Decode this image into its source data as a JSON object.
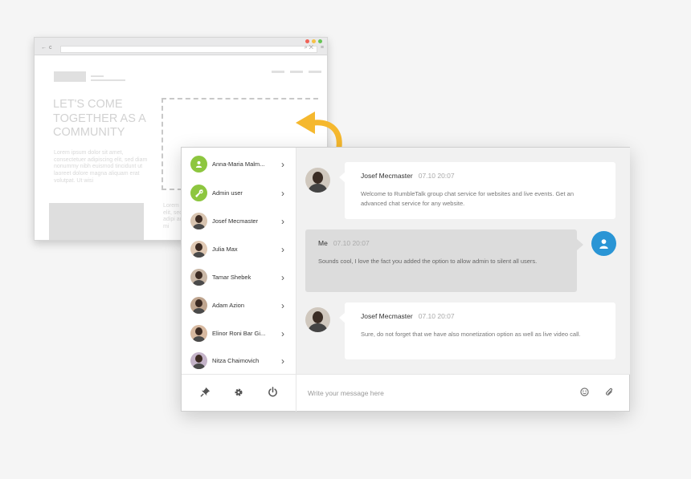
{
  "browser": {
    "hero_title": "LET'S COME TOGETHER AS A COMMUNITY",
    "hero_text": "Lorem ipsum dolor sit amet, consectetuer adipiscing elit, sed diam nonummy nibh euismod tincidunt ut laoreet dolore magna aliquam erat volutpat. Ut wisi",
    "side_text": "Lorem elit, sed adipi ad mi"
  },
  "sidebar": {
    "users": [
      {
        "name": "Anna-Maria Malm...",
        "avatar": "user-icon"
      },
      {
        "name": "Admin user",
        "avatar": "wrench-icon"
      },
      {
        "name": "Josef Mecmaster",
        "avatar": "photo"
      },
      {
        "name": "Julia Max",
        "avatar": "photo"
      },
      {
        "name": "Tamar Shebek",
        "avatar": "photo"
      },
      {
        "name": "Adam Azion",
        "avatar": "photo"
      },
      {
        "name": "Elinor Roni Bar Gi...",
        "avatar": "photo"
      },
      {
        "name": "Nitza Chaimovich",
        "avatar": "photo"
      }
    ],
    "footer_icons": [
      "pin-icon",
      "gear-icon",
      "power-icon"
    ]
  },
  "messages": [
    {
      "author": "Josef Mecmaster",
      "time": "07.10 20:07",
      "text": "Welcome to RumbleTalk group chat service for websites and live events. Get an advanced chat service for any website."
    },
    {
      "author": "Me",
      "time": "07.10 20:07",
      "text": "Sounds cool, I love the fact you added the option to allow admin to silent all users."
    },
    {
      "author": "Josef Mecmaster",
      "time": "07.10 20:07",
      "text": "Sure, do not forget that we have also monetization option as well as live video call."
    }
  ],
  "composer": {
    "placeholder": "Write your message here"
  },
  "colors": {
    "accent_blue": "#2a95d5",
    "admin_green": "#8dc63f",
    "arrow_yellow": "#f5b82e"
  }
}
